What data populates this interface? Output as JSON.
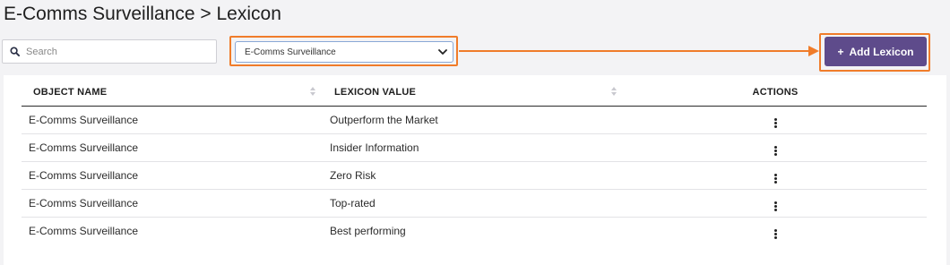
{
  "page": {
    "title": "E-Comms Surveillance > Lexicon"
  },
  "search": {
    "placeholder": "Search",
    "value": ""
  },
  "filter": {
    "selected": "E-Comms Surveillance"
  },
  "toolbar": {
    "add_label": "Add Lexicon",
    "add_icon": "plus-icon"
  },
  "table": {
    "columns": [
      "OBJECT NAME",
      "LEXICON VALUE",
      "ACTIONS"
    ],
    "rows": [
      {
        "object_name": "E-Comms Surveillance",
        "lexicon_value": "Outperform the Market"
      },
      {
        "object_name": "E-Comms Surveillance",
        "lexicon_value": "Insider Information"
      },
      {
        "object_name": "E-Comms Surveillance",
        "lexicon_value": "Zero Risk"
      },
      {
        "object_name": "E-Comms Surveillance",
        "lexicon_value": "Top-rated"
      },
      {
        "object_name": "E-Comms Surveillance",
        "lexicon_value": "Best performing"
      }
    ]
  },
  "colors": {
    "accent": "#5e4b8b",
    "highlight": "#f07c2a",
    "background": "#f3f3f5"
  }
}
